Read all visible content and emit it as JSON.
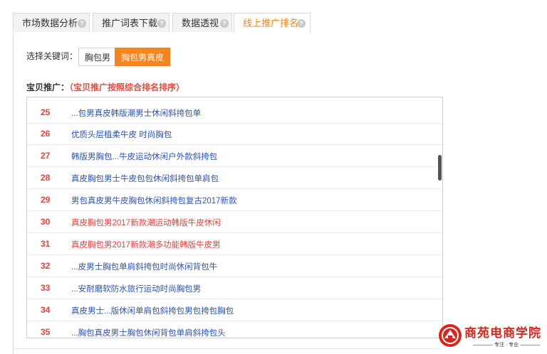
{
  "tabs": [
    {
      "label": "市场数据分析",
      "active": false
    },
    {
      "label": "推广词表下载",
      "active": false
    },
    {
      "label": "数据透视",
      "active": false
    },
    {
      "label": "线上推广排名",
      "active": true
    }
  ],
  "keyword": {
    "label": "选择关键词：",
    "options": [
      {
        "label": "胸包男",
        "selected": false
      },
      {
        "label": "胸包男真皮",
        "selected": true
      }
    ]
  },
  "section": {
    "title": "宝贝推广：",
    "note": "（宝贝推广按照综合排名排序）"
  },
  "rows": [
    {
      "rank": "25",
      "title": "...包男真皮韩版潮男士休闲斜挎包单",
      "highlight": false
    },
    {
      "rank": "26",
      "title": "优质头层植柔牛皮 时尚胸包",
      "highlight": false
    },
    {
      "rank": "27",
      "title": "韩版男胸包...牛皮运动休闲户外款斜挎包",
      "highlight": false
    },
    {
      "rank": "28",
      "title": "真皮胸包男士牛皮包包休闲斜挎包单肩包",
      "highlight": false
    },
    {
      "rank": "29",
      "title": "男包真皮男牛皮胸包休闲斜挎包复古2017新款",
      "highlight": false
    },
    {
      "rank": "30",
      "title": "真皮胸包男2017新款潮运动韩版牛皮休闲",
      "highlight": true
    },
    {
      "rank": "31",
      "title": "真皮胸包男2017新款潮多功能韩版牛皮男",
      "highlight": true
    },
    {
      "rank": "32",
      "title": "...皮男士胸包单肩斜挎包时尚休闲背包牛",
      "highlight": false
    },
    {
      "rank": "33",
      "title": "...安耐磨软防水旅行运动时尚胸包男",
      "highlight": false
    },
    {
      "rank": "34",
      "title": "真皮男士...版休闲单肩包斜挎包男包挎包胸包",
      "highlight": false
    },
    {
      "rank": "35",
      "title": "...胸包真皮男士胸包休闲背包单肩斜挎包头",
      "highlight": false
    }
  ],
  "logo": {
    "text": "商苑电商学院",
    "sub": "———— 专注 · 专业 ————",
    "color": "#d9251d"
  },
  "colors": {
    "accent": "#f5851f",
    "rank": "#e8433f",
    "link": "#2f55b0"
  }
}
